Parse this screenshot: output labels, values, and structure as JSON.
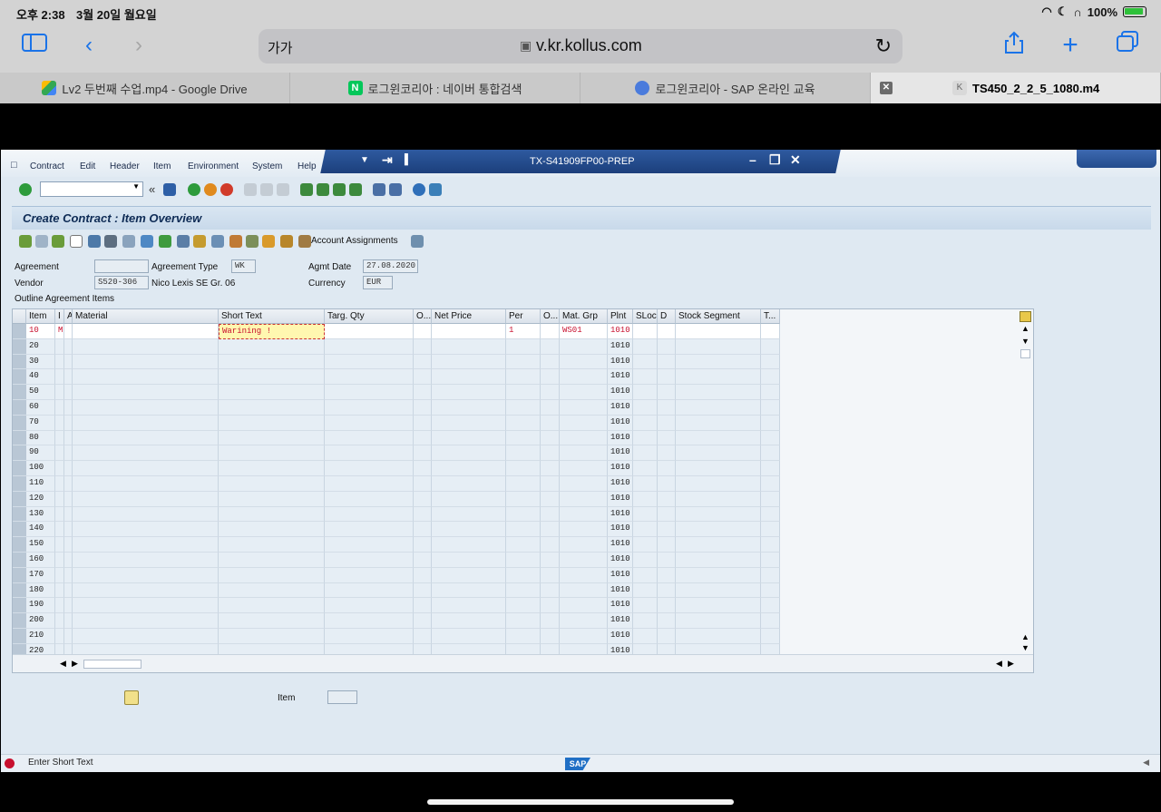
{
  "device": {
    "time": "오후 2:38",
    "date": "3월 20일 월요일",
    "battery": "100%"
  },
  "browser": {
    "text_size_label": "가가",
    "url": "v.kr.kollus.com",
    "tabs": [
      {
        "label": "Lv2 두번째 수업.mp4 - Google Drive"
      },
      {
        "label": "로그윈코리아 : 네이버 통합검색"
      },
      {
        "label": "로그윈코리아 - SAP 온라인 교육"
      },
      {
        "label": "TS450_2_2_5_1080.m4"
      }
    ]
  },
  "sap": {
    "menu": [
      "Contract",
      "Edit",
      "Header",
      "Item",
      "Environment",
      "System",
      "Help"
    ],
    "system_title": "TX-S41909FP00-PREP",
    "screen_title": "Create Contract : Item Overview",
    "account_assignments_label": "Account Assignments",
    "header": {
      "agreement_label": "Agreement",
      "agreement_value": "",
      "agreement_type_label": "Agreement Type",
      "agreement_type_value": "WK",
      "agmt_date_label": "Agmt Date",
      "agmt_date_value": "27.08.2020",
      "vendor_label": "Vendor",
      "vendor_value": "S520-306",
      "vendor_name": "Nico Lexis SE Gr. 06",
      "currency_label": "Currency",
      "currency_value": "EUR",
      "outline_label": "Outline Agreement Items"
    },
    "columns": [
      "Item",
      "I",
      "A",
      "Material",
      "Short Text",
      "Targ. Qty",
      "O...",
      "Net Price",
      "Per",
      "O...",
      "Mat. Grp",
      "Plnt",
      "SLoc",
      "D",
      "Stock Segment",
      "T..."
    ],
    "rows": [
      {
        "item": "10",
        "i": "M",
        "short_text": "Warining !",
        "per": "1",
        "mat_grp": "WS01",
        "plnt": "1010"
      },
      {
        "item": "20",
        "plnt": "1010"
      },
      {
        "item": "30",
        "plnt": "1010"
      },
      {
        "item": "40",
        "plnt": "1010"
      },
      {
        "item": "50",
        "plnt": "1010"
      },
      {
        "item": "60",
        "plnt": "1010"
      },
      {
        "item": "70",
        "plnt": "1010"
      },
      {
        "item": "80",
        "plnt": "1010"
      },
      {
        "item": "90",
        "plnt": "1010"
      },
      {
        "item": "100",
        "plnt": "1010"
      },
      {
        "item": "110",
        "plnt": "1010"
      },
      {
        "item": "120",
        "plnt": "1010"
      },
      {
        "item": "130",
        "plnt": "1010"
      },
      {
        "item": "140",
        "plnt": "1010"
      },
      {
        "item": "150",
        "plnt": "1010"
      },
      {
        "item": "160",
        "plnt": "1010"
      },
      {
        "item": "170",
        "plnt": "1010"
      },
      {
        "item": "180",
        "plnt": "1010"
      },
      {
        "item": "190",
        "plnt": "1010"
      },
      {
        "item": "200",
        "plnt": "1010"
      },
      {
        "item": "210",
        "plnt": "1010"
      },
      {
        "item": "220",
        "plnt": "1010"
      }
    ],
    "footer": {
      "item_label": "Item",
      "item_value": ""
    },
    "status_message": "Enter Short Text",
    "logo_text": "SAP"
  }
}
